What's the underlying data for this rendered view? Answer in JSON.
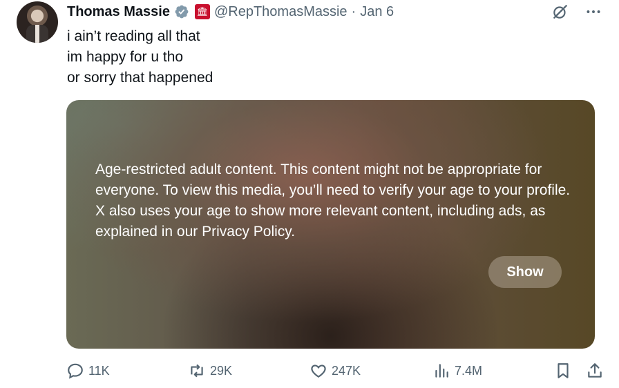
{
  "author": {
    "name": "Thomas Massie",
    "handle": "@RepThomasMassie",
    "separator": "·",
    "date": "Jan 6"
  },
  "tweet": {
    "lines": [
      "i ain’t reading all that",
      "im happy for u tho",
      "or sorry that happened"
    ]
  },
  "media": {
    "message": "Age-restricted adult content. This content might not be appropriate for everyone. To view this media, you’ll need to verify your age to your profile. X also uses your age to show more relevant content, including ads, as explained in our Privacy Policy.",
    "show_label": "Show"
  },
  "actions": {
    "replies": "11K",
    "reposts": "29K",
    "likes": "247K",
    "views": "7.4M"
  },
  "icons": [
    "verified-badge-icon",
    "capitol-affiliation-icon",
    "grok-icon",
    "more-icon",
    "reply-icon",
    "repost-icon",
    "like-icon",
    "views-icon",
    "bookmark-icon",
    "share-icon"
  ],
  "colors": {
    "text": "#0f1419",
    "secondary": "#536471",
    "verified": "#829aab",
    "affiliation": "#c8102e"
  }
}
